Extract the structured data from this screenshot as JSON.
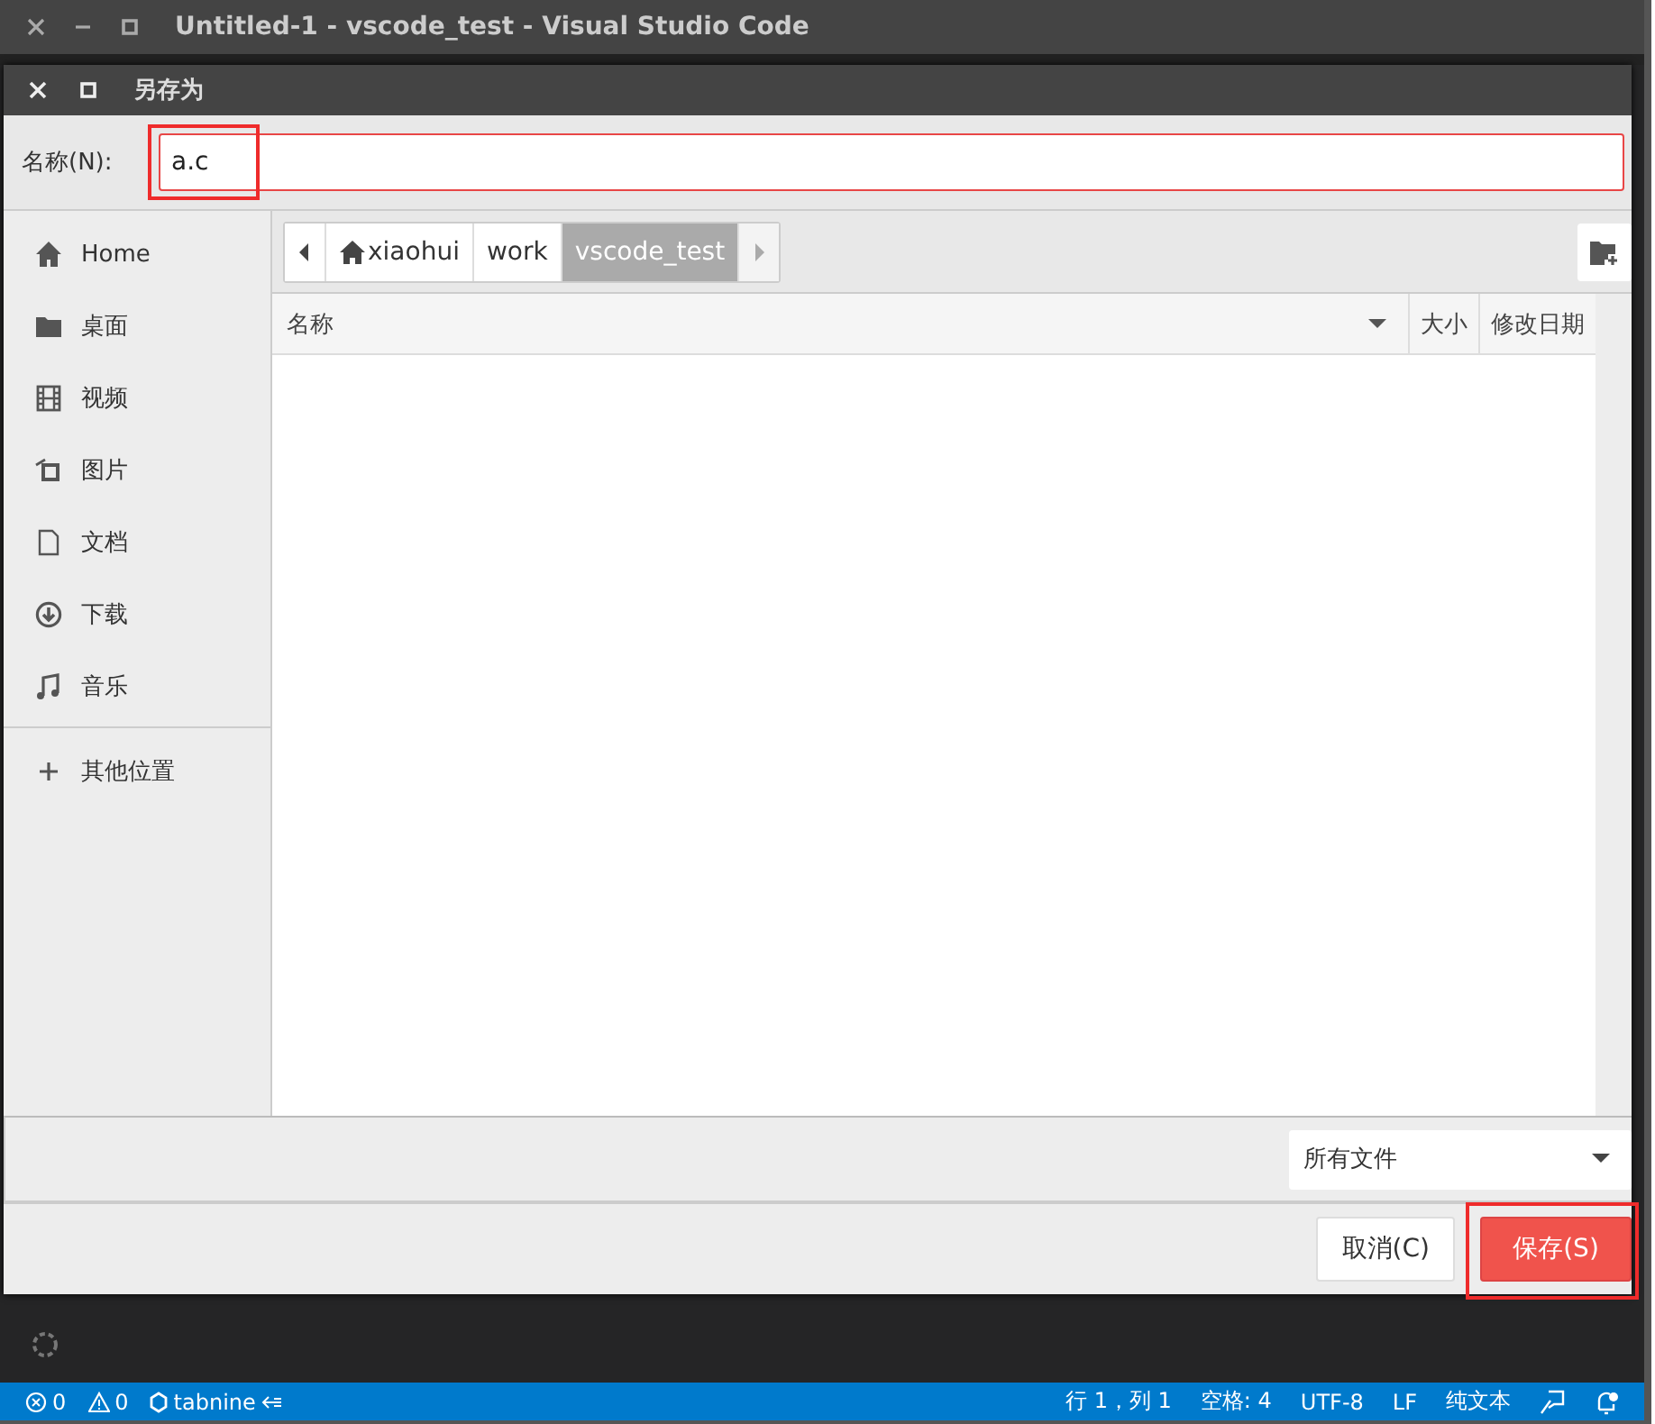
{
  "window": {
    "title": "Untitled-1 - vscode_test - Visual Studio Code"
  },
  "dialog": {
    "title": "另存为",
    "name_field": {
      "label": "名称(N):",
      "value": "a.c",
      "highlighted": true
    },
    "sidebar": {
      "items": [
        {
          "label": "Home"
        },
        {
          "label": "桌面"
        },
        {
          "label": "视频"
        },
        {
          "label": "图片"
        },
        {
          "label": "文档"
        },
        {
          "label": "下载"
        },
        {
          "label": "音乐"
        }
      ],
      "other": {
        "label": "其他位置"
      }
    },
    "path": [
      {
        "label": "xiaohui",
        "selected": false
      },
      {
        "label": "work",
        "selected": false
      },
      {
        "label": "vscode_test",
        "selected": true
      }
    ],
    "columns": [
      {
        "label": "名称",
        "sorted": true
      },
      {
        "label": "大小",
        "sorted": false
      },
      {
        "label": "修改日期",
        "sorted": false
      }
    ],
    "filter": {
      "value": "所有文件"
    },
    "buttons": [
      {
        "label": "取消(C)",
        "kind": "plain",
        "highlighted": false
      },
      {
        "label": "保存(S)",
        "kind": "primary",
        "highlighted": true
      }
    ]
  },
  "status_bar": {
    "left": [
      {
        "kind": "errors",
        "text": "0"
      },
      {
        "kind": "warnings",
        "text": "0"
      },
      {
        "kind": "tabnine",
        "text": "tabnine"
      }
    ],
    "right": [
      {
        "kind": "text",
        "text": "行 1，列 1"
      },
      {
        "kind": "text",
        "text": "空格: 4"
      },
      {
        "kind": "text",
        "text": "UTF-8"
      },
      {
        "kind": "text",
        "text": "LF"
      },
      {
        "kind": "text",
        "text": "纯文本"
      },
      {
        "kind": "feedback"
      },
      {
        "kind": "bell"
      }
    ]
  }
}
